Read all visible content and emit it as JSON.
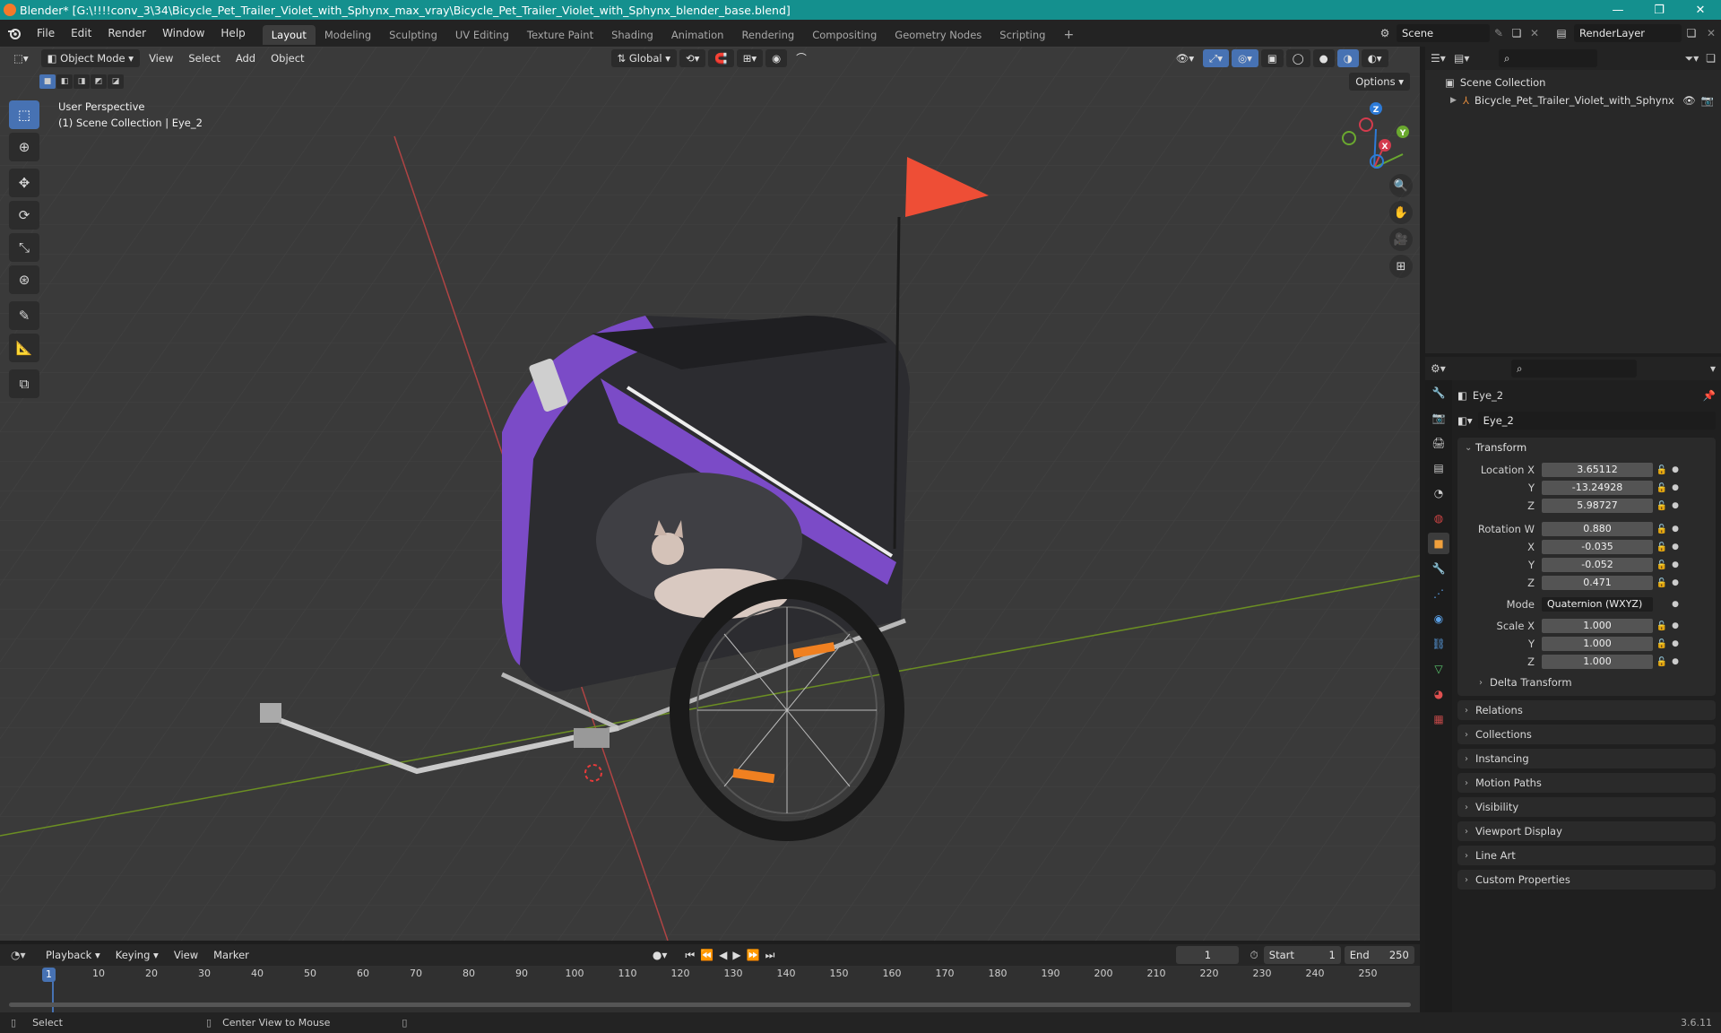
{
  "window": {
    "title": "Blender* [G:\\!!!!conv_3\\34\\Bicycle_Pet_Trailer_Violet_with_Sphynx_max_vray\\Bicycle_Pet_Trailer_Violet_with_Sphynx_blender_base.blend]",
    "minimize": "—",
    "maximize": "❐",
    "close": "✕"
  },
  "menus": [
    "File",
    "Edit",
    "Render",
    "Window",
    "Help"
  ],
  "workspaces": [
    "Layout",
    "Modeling",
    "Sculpting",
    "UV Editing",
    "Texture Paint",
    "Shading",
    "Animation",
    "Rendering",
    "Compositing",
    "Geometry Nodes",
    "Scripting",
    "+"
  ],
  "active_workspace": "Layout",
  "scene_name": "Scene",
  "render_layer": "RenderLayer",
  "viewport": {
    "mode": "Object Mode",
    "menus": [
      "View",
      "Select",
      "Add",
      "Object"
    ],
    "orientation": "Global",
    "options": "Options",
    "perspective": "User Perspective",
    "collection_info": "(1) Scene Collection | Eye_2",
    "axes": {
      "x": "X",
      "y": "Y",
      "z": "Z"
    }
  },
  "outliner": {
    "root": "Scene Collection",
    "items": [
      {
        "name": "Bicycle_Pet_Trailer_Violet_with_Sphynx"
      }
    ]
  },
  "properties": {
    "object_name": "Eye_2",
    "data_name": "Eye_2",
    "transform_label": "Transform",
    "location": {
      "label": "Location X",
      "x": "3.65112",
      "y": "-13.24928",
      "z": "5.98727"
    },
    "rotation": {
      "label": "Rotation W",
      "w": "0.880",
      "x": "-0.035",
      "y": "-0.052",
      "z": "0.471"
    },
    "mode": {
      "label": "Mode",
      "value": "Quaternion (WXYZ)"
    },
    "scale": {
      "label": "Scale X",
      "x": "1.000",
      "y": "1.000",
      "z": "1.000"
    },
    "axis_y": "Y",
    "axis_z": "Z",
    "axis_x": "X",
    "delta": "Delta Transform",
    "panels": [
      "Relations",
      "Collections",
      "Instancing",
      "Motion Paths",
      "Visibility",
      "Viewport Display",
      "Line Art",
      "Custom Properties"
    ]
  },
  "timeline": {
    "menus": [
      "Playback",
      "Keying",
      "View",
      "Marker"
    ],
    "current_frame": "1",
    "start_label": "Start",
    "start": "1",
    "end_label": "End",
    "end": "250",
    "ticks": [
      "10",
      "20",
      "30",
      "40",
      "50",
      "60",
      "70",
      "80",
      "90",
      "100",
      "110",
      "120",
      "130",
      "140",
      "150",
      "160",
      "170",
      "180",
      "190",
      "200",
      "210",
      "220",
      "230",
      "240",
      "250"
    ]
  },
  "status": {
    "select": "Select",
    "center": "Center View to Mouse",
    "version": "3.6.11"
  }
}
